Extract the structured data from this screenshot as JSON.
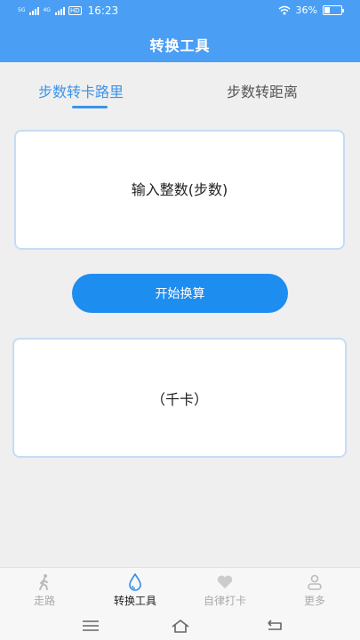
{
  "status_bar": {
    "signal1": "5G",
    "signal2": "4G",
    "hd": "HD",
    "time": "16:23",
    "battery_percent": "36%",
    "battery_level": 0.36
  },
  "app": {
    "title": "转换工具"
  },
  "tabs": [
    {
      "label": "步数转卡路里",
      "active": true
    },
    {
      "label": "步数转距离",
      "active": false
    }
  ],
  "input": {
    "placeholder": "输入整数(步数)",
    "value": ""
  },
  "calculate_button": {
    "label": "开始换算"
  },
  "result": {
    "text": "（千卡）"
  },
  "bottom_nav": [
    {
      "label": "走路",
      "icon": "walking-person-icon",
      "active": false
    },
    {
      "label": "转换工具",
      "icon": "water-drop-icon",
      "active": true
    },
    {
      "label": "自律打卡",
      "icon": "heart-icon",
      "active": false
    },
    {
      "label": "更多",
      "icon": "user-icon",
      "active": false
    }
  ],
  "system_nav": {
    "icons": [
      "menu-icon",
      "home-icon",
      "back-icon"
    ]
  },
  "colors": {
    "header": "#4a9ff5",
    "accent": "#3c93e6",
    "button": "#1e8df0",
    "background": "#efefef"
  }
}
